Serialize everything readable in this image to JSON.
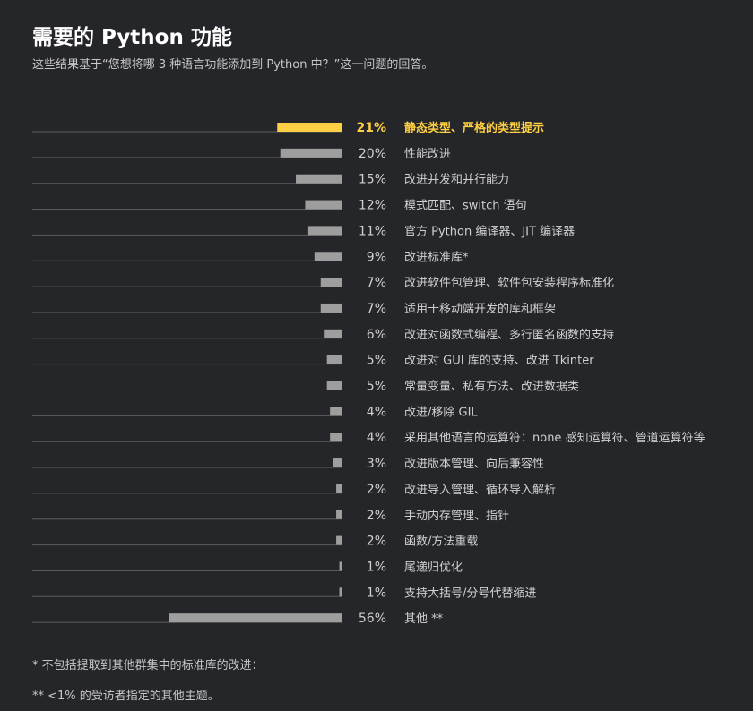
{
  "header": {
    "title": "需要的 Python 功能",
    "subtitle": "这些结果基于“您想将哪 3 种语言功能添加到 Python 中？”这一问题的回答。"
  },
  "colors": {
    "background": "#252629",
    "highlight": "#ffd043",
    "bar": "#9e9e9e",
    "baseline": "#5d5d5d",
    "text": "#d0d0d0"
  },
  "chart_data": {
    "type": "bar",
    "orientation": "horizontal",
    "title": "需要的 Python 功能",
    "highlight_index": 0,
    "xlim": [
      0,
      56
    ],
    "grid": false,
    "legend": "none",
    "categories": [
      "静态类型、严格的类型提示",
      "性能改进",
      "改进并发和并行能力",
      "模式匹配、switch 语句",
      "官方 Python 编译器、JIT 编译器",
      "改进标准库*",
      "改进软件包管理、软件包安装程序标准化",
      "适用于移动端开发的库和框架",
      "改进对函数式编程、多行匿名函数的支持",
      "改进对 GUI 库的支持、改进 Tkinter",
      "常量变量、私有方法、改进数据类",
      "改进/移除 GIL",
      "采用其他语言的运算符：none 感知运算符、管道运算符等",
      "改进版本管理、向后兼容性",
      "改进导入管理、循环导入解析",
      "手动内存管理、指针",
      "函数/方法重载",
      "尾递归优化",
      "支持大括号/分号代替缩进",
      "其他 **"
    ],
    "values": [
      21,
      20,
      15,
      12,
      11,
      9,
      7,
      7,
      6,
      5,
      5,
      4,
      4,
      3,
      2,
      2,
      2,
      1,
      1,
      56
    ],
    "value_labels": [
      "21%",
      "20%",
      "15%",
      "12%",
      "11%",
      "9%",
      "7%",
      "7%",
      "6%",
      "5%",
      "5%",
      "4%",
      "4%",
      "3%",
      "2%",
      "2%",
      "2%",
      "1%",
      "1%",
      "56%"
    ]
  },
  "footnotes": {
    "note1": "* 不包括提取到其他群集中的标准库的改进：",
    "note2": "** <1% 的受访者指定的其他主题。"
  }
}
